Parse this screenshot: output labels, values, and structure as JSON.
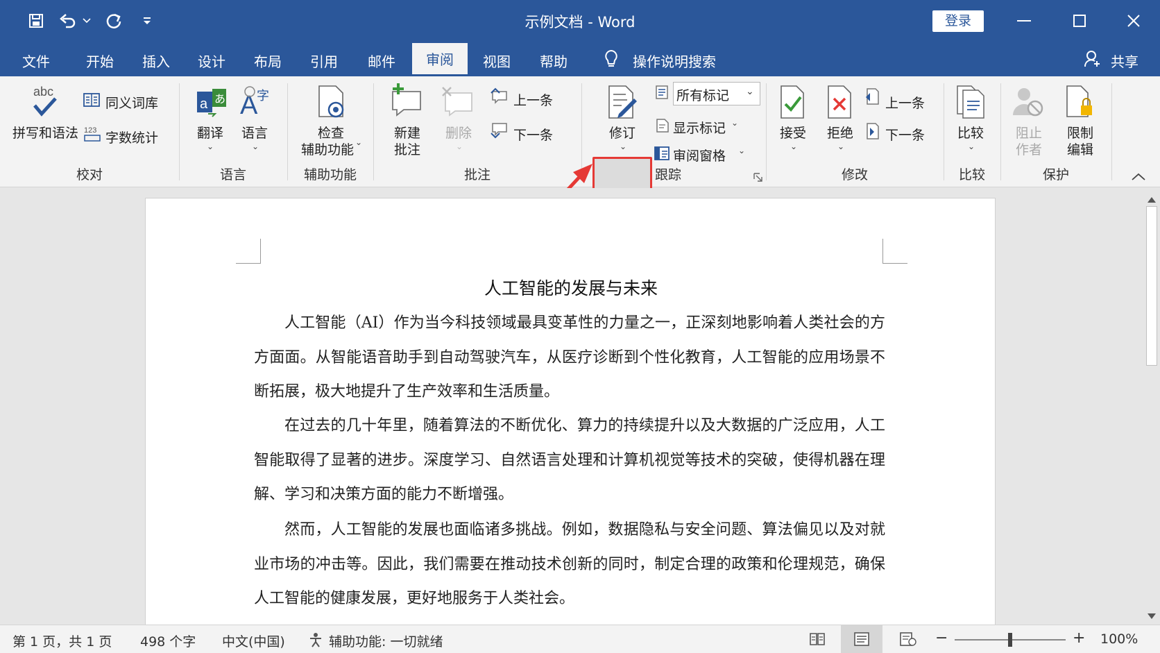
{
  "window": {
    "title": "示例文档  -  Word",
    "login_label": "登录"
  },
  "tabs": [
    {
      "label": "文件"
    },
    {
      "label": "开始"
    },
    {
      "label": "插入"
    },
    {
      "label": "设计"
    },
    {
      "label": "布局"
    },
    {
      "label": "引用"
    },
    {
      "label": "邮件"
    },
    {
      "label": "审阅",
      "active": true
    },
    {
      "label": "视图"
    },
    {
      "label": "帮助"
    }
  ],
  "tell_me": "操作说明搜索",
  "share": "共享",
  "ribbon": {
    "proofing": {
      "label": "校对",
      "spelling": "拼写和语法",
      "spelling_icon_text": "abc",
      "thesaurus": "同义词库",
      "wordcount": "字数统计",
      "wordcount_icon_text": "123"
    },
    "language": {
      "label": "语言",
      "translate": "翻译",
      "language": "语言"
    },
    "accessibility": {
      "label": "辅助功能",
      "check_line1": "检查",
      "check_line2": "辅助功能"
    },
    "comments": {
      "label": "批注",
      "new_line1": "新建",
      "new_line2": "批注",
      "delete": "删除",
      "previous": "上一条",
      "next": "下一条"
    },
    "tracking": {
      "label": "跟踪",
      "track_changes": "修订",
      "markup_select": "所有标记",
      "show_markup": "显示标记",
      "reviewing_pane": "审阅窗格"
    },
    "changes": {
      "label": "修改",
      "accept": "接受",
      "reject": "拒绝",
      "previous": "上一条",
      "next": "下一条"
    },
    "compare": {
      "label": "比较",
      "compare": "比较"
    },
    "protect": {
      "label": "保护",
      "block_line1": "阻止",
      "block_line2": "作者",
      "restrict_line1": "限制",
      "restrict_line2": "编辑"
    }
  },
  "document": {
    "heading": "人工智能的发展与未来",
    "paragraphs": [
      "人工智能（AI）作为当今科技领域最具变革性的力量之一，正深刻地影响着人类社会的方方面面。从智能语音助手到自动驾驶汽车，从医疗诊断到个性化教育，人工智能的应用场景不断拓展，极大地提升了生产效率和生活质量。",
      "在过去的几十年里，随着算法的不断优化、算力的持续提升以及大数据的广泛应用，人工智能取得了显著的进步。深度学习、自然语言处理和计算机视觉等技术的突破，使得机器在理解、学习和决策方面的能力不断增强。",
      "然而，人工智能的发展也面临诸多挑战。例如，数据隐私与安全问题、算法偏见以及对就业市场的冲击等。因此，我们需要在推动技术创新的同时，制定合理的政策和伦理规范，确保人工智能的健康发展，更好地服务于人类社会。"
    ]
  },
  "status": {
    "page": "第 1 页，共 1 页",
    "words": "498 个字",
    "language": "中文(中国)",
    "accessibility": "辅助功能: 一切就绪",
    "zoom": "100%",
    "zoom_fraction": 0.5
  },
  "colors": {
    "brand": "#2b579a",
    "highlight": "#e53935"
  }
}
